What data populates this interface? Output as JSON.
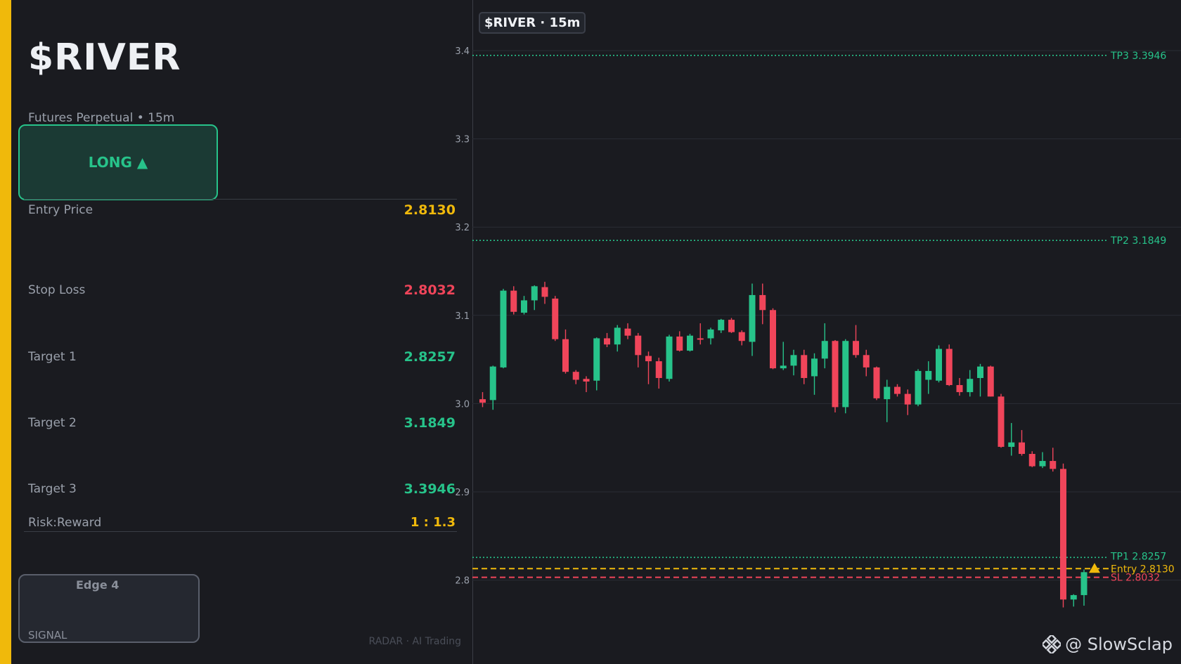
{
  "header": {
    "ticker": "$RIVER",
    "subtitle": "Futures Perpetual  •  15m",
    "direction": "LONG ▲"
  },
  "levels": [
    {
      "label": "Entry Price",
      "value": "2.8130",
      "color": "#f0b90b"
    },
    {
      "label": "Stop Loss",
      "value": "2.8032",
      "color": "#f0455a"
    },
    {
      "label": "Target 1",
      "value": "2.8257",
      "color": "#27c38a"
    },
    {
      "label": "Target 2",
      "value": "3.1849",
      "color": "#27c38a"
    },
    {
      "label": "Target 3",
      "value": "3.3946",
      "color": "#27c38a"
    }
  ],
  "risk_reward": {
    "label": "Risk:Reward",
    "value": "1 : 1.3"
  },
  "edge": {
    "label": "Edge 4",
    "signal": "SIGNAL"
  },
  "brand": "RADAR · AI Trading",
  "chart": {
    "title": "$RIVER · 15m",
    "watermark": "@ SlowSclap",
    "watermark_icon": "binance-diamond-icon",
    "yticks": [
      2.8,
      2.9,
      3.0,
      3.1,
      3.2,
      3.3,
      3.4
    ],
    "ylim": [
      2.74,
      3.45
    ],
    "lines": [
      {
        "label": "TP3 3.3946",
        "value": 3.3946,
        "color": "#27c38a",
        "style": "dotted"
      },
      {
        "label": "TP2 3.1849",
        "value": 3.1849,
        "color": "#27c38a",
        "style": "dotted"
      },
      {
        "label": "TP1 2.8257",
        "value": 2.8257,
        "color": "#27c38a",
        "style": "dotted"
      },
      {
        "label": "Entry 2.8130",
        "value": 2.813,
        "color": "#f0b90b",
        "style": "dashed"
      },
      {
        "label": "SL 2.8032",
        "value": 2.8032,
        "color": "#f0455a",
        "style": "dashed"
      }
    ],
    "colors": {
      "up": "#27c38a",
      "down": "#f0455a",
      "grid": "#2a2d34",
      "text": "#9aa0ab"
    }
  },
  "chart_data": {
    "type": "candlestick",
    "columns": [
      "open",
      "high",
      "low",
      "close"
    ],
    "candles": [
      [
        3.005,
        3.013,
        2.996,
        3.001
      ],
      [
        3.004,
        3.043,
        2.993,
        3.042
      ],
      [
        3.041,
        3.13,
        3.04,
        3.128
      ],
      [
        3.128,
        3.133,
        3.101,
        3.104
      ],
      [
        3.103,
        3.122,
        3.101,
        3.117
      ],
      [
        3.117,
        3.134,
        3.106,
        3.133
      ],
      [
        3.132,
        3.138,
        3.113,
        3.121
      ],
      [
        3.119,
        3.122,
        3.071,
        3.073
      ],
      [
        3.073,
        3.084,
        3.034,
        3.036
      ],
      [
        3.036,
        3.038,
        3.022,
        3.027
      ],
      [
        3.028,
        3.031,
        3.013,
        3.025
      ],
      [
        3.026,
        3.075,
        3.015,
        3.074
      ],
      [
        3.074,
        3.08,
        3.064,
        3.067
      ],
      [
        3.067,
        3.089,
        3.059,
        3.086
      ],
      [
        3.085,
        3.091,
        3.073,
        3.077
      ],
      [
        3.077,
        3.08,
        3.041,
        3.055
      ],
      [
        3.054,
        3.059,
        3.022,
        3.048
      ],
      [
        3.048,
        3.052,
        3.017,
        3.029
      ],
      [
        3.028,
        3.078,
        3.025,
        3.076
      ],
      [
        3.076,
        3.082,
        3.059,
        3.06
      ],
      [
        3.06,
        3.079,
        3.059,
        3.077
      ],
      [
        3.074,
        3.091,
        3.067,
        3.073
      ],
      [
        3.074,
        3.086,
        3.067,
        3.084
      ],
      [
        3.083,
        3.096,
        3.08,
        3.095
      ],
      [
        3.095,
        3.097,
        3.08,
        3.081
      ],
      [
        3.081,
        3.083,
        3.066,
        3.071
      ],
      [
        3.07,
        3.136,
        3.054,
        3.123
      ],
      [
        3.123,
        3.136,
        3.09,
        3.106
      ],
      [
        3.106,
        3.108,
        3.039,
        3.04
      ],
      [
        3.04,
        3.07,
        3.038,
        3.043
      ],
      [
        3.043,
        3.061,
        3.032,
        3.055
      ],
      [
        3.055,
        3.061,
        3.022,
        3.029
      ],
      [
        3.031,
        3.057,
        3.01,
        3.051
      ],
      [
        3.051,
        3.091,
        3.04,
        3.071
      ],
      [
        3.071,
        3.072,
        2.99,
        2.996
      ],
      [
        2.996,
        3.073,
        2.989,
        3.071
      ],
      [
        3.071,
        3.089,
        3.052,
        3.055
      ],
      [
        3.055,
        3.061,
        3.031,
        3.041
      ],
      [
        3.041,
        3.042,
        3.004,
        3.006
      ],
      [
        3.005,
        3.027,
        2.979,
        3.019
      ],
      [
        3.019,
        3.022,
        3.008,
        3.011
      ],
      [
        3.011,
        3.016,
        2.987,
        2.999
      ],
      [
        2.999,
        3.039,
        2.997,
        3.037
      ],
      [
        3.027,
        3.048,
        3.011,
        3.037
      ],
      [
        3.026,
        3.066,
        3.024,
        3.062
      ],
      [
        3.062,
        3.067,
        3.02,
        3.021
      ],
      [
        3.021,
        3.029,
        3.009,
        3.013
      ],
      [
        3.013,
        3.038,
        3.008,
        3.028
      ],
      [
        3.029,
        3.045,
        3.008,
        3.042
      ],
      [
        3.042,
        3.043,
        3.008,
        3.008
      ],
      [
        3.008,
        3.011,
        2.95,
        2.951
      ],
      [
        2.951,
        2.978,
        2.941,
        2.956
      ],
      [
        2.956,
        2.97,
        2.941,
        2.943
      ],
      [
        2.943,
        2.946,
        2.928,
        2.929
      ],
      [
        2.929,
        2.945,
        2.927,
        2.935
      ],
      [
        2.935,
        2.95,
        2.923,
        2.926
      ],
      [
        2.926,
        2.932,
        2.769,
        2.778
      ],
      [
        2.778,
        2.784,
        2.77,
        2.783
      ],
      [
        2.783,
        2.812,
        2.771,
        2.809
      ]
    ]
  }
}
